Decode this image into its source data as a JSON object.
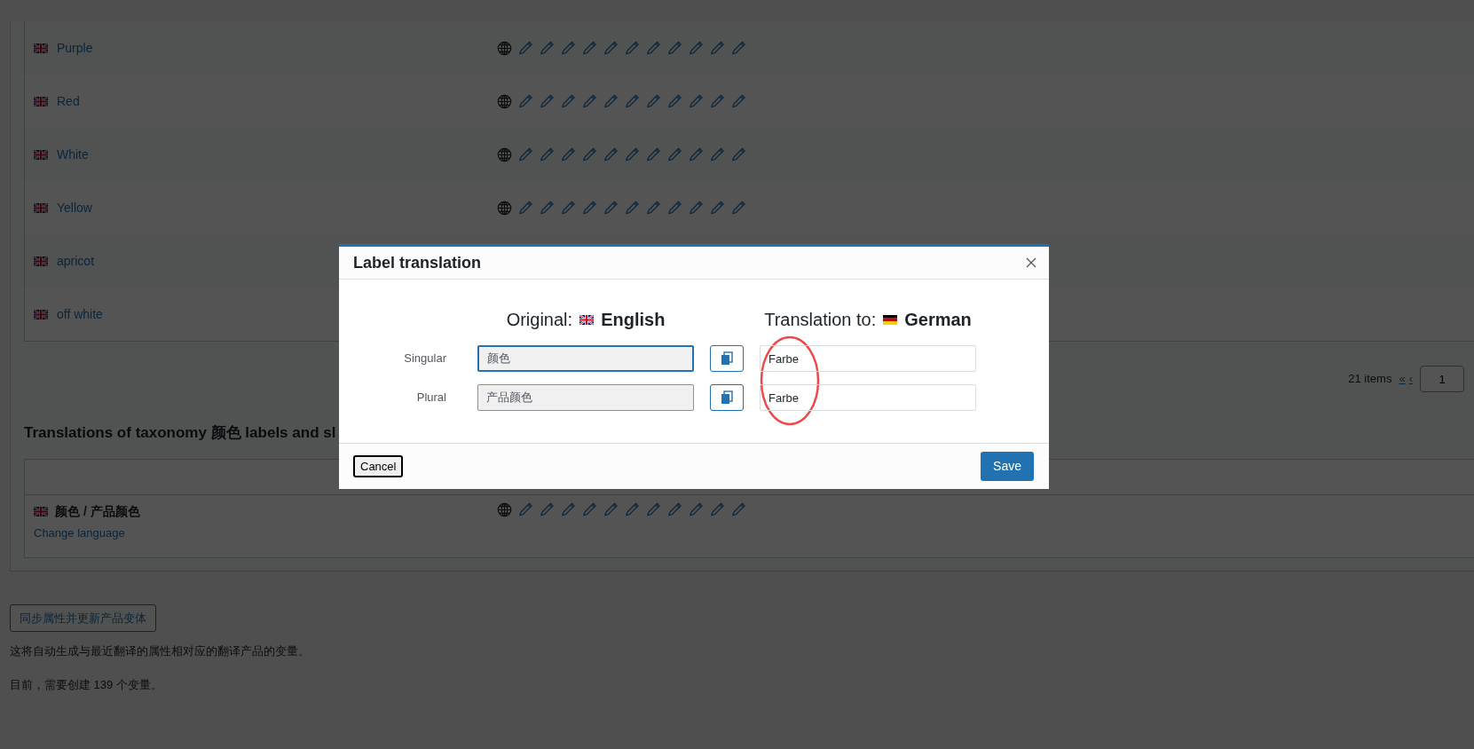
{
  "terms_table": {
    "rows": [
      {
        "name": "Purple"
      },
      {
        "name": "Red"
      },
      {
        "name": "White"
      },
      {
        "name": "Yellow"
      },
      {
        "name": "apricot"
      },
      {
        "name": "off white"
      }
    ]
  },
  "pagination": {
    "count": "21 items",
    "first": "«",
    "prev": "‹",
    "page": "1"
  },
  "taxonomy_section": {
    "heading": "Translations of taxonomy 颜色 labels and sl",
    "rows": [
      {
        "name": "颜色 / 产品颜色",
        "link": "Change language"
      }
    ]
  },
  "sync_button": "同步属性并更新产品变体",
  "notes": [
    "这将自动生成与最近翻译的属性相对应的翻译产品的变量。",
    "目前，需要创建 139 个变量。"
  ],
  "modal": {
    "title": "Label translation",
    "original_label": "Original:",
    "original_language": "English",
    "translation_label": "Translation to:",
    "translation_language": "German",
    "fields": [
      {
        "label": "Singular",
        "original": "颜色",
        "translation": "Farbe",
        "focused": true
      },
      {
        "label": "Plural",
        "original": "产品颜色",
        "translation": "Farbe",
        "focused": false
      }
    ],
    "cancel": "Cancel",
    "save": "Save"
  }
}
